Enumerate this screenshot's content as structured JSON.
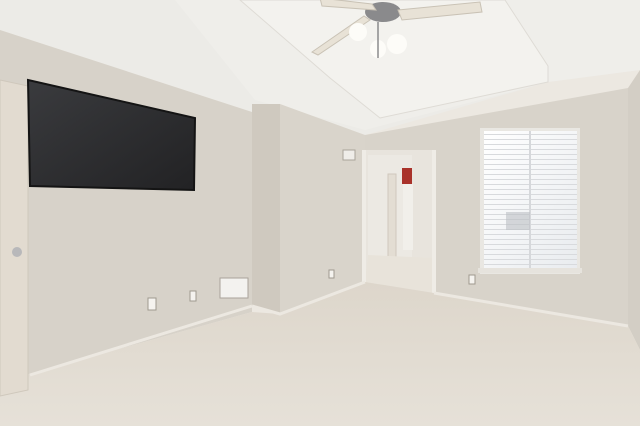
{
  "scene": {
    "description_kind": "empty bedroom interior photo",
    "colors": {
      "wall": "#d6d1c8",
      "wall_shadow": "#c9c3b8",
      "ceiling": "#eceae6",
      "carpet": "#e3ddd2",
      "tv": "#2a2a2c",
      "window": "#f6f7f8",
      "door": "#e2dbd0",
      "accent_red": "#a9322a"
    }
  }
}
